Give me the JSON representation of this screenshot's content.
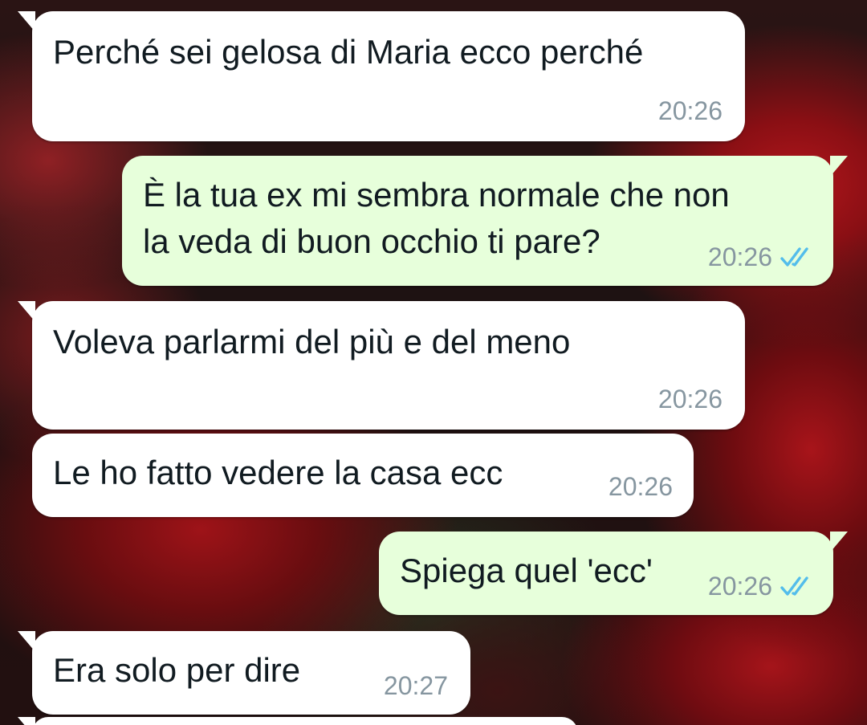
{
  "messages": [
    {
      "direction": "incoming",
      "text": "Perché sei gelosa di Maria ecco perché",
      "time": "20:26"
    },
    {
      "direction": "outgoing",
      "text": "È la tua ex mi sembra normale che non\nla veda di buon occhio ti pare?",
      "time": "20:26",
      "status": "read"
    },
    {
      "direction": "incoming",
      "text": "Voleva parlarmi del più e del meno",
      "time": "20:26"
    },
    {
      "direction": "incoming",
      "text": "Le ho fatto vedere la casa ecc",
      "time": "20:26"
    },
    {
      "direction": "outgoing",
      "text": "Spiega quel 'ecc'",
      "time": "20:26",
      "status": "read"
    },
    {
      "direction": "incoming",
      "text": "Era solo per dire",
      "time": "20:27"
    }
  ],
  "colors": {
    "incoming_bubble": "#ffffff",
    "outgoing_bubble": "#e7ffdb",
    "timestamp": "#8696a0",
    "read_ticks": "#53bdeb"
  },
  "icons": {
    "read_receipt": "double-check-icon"
  }
}
